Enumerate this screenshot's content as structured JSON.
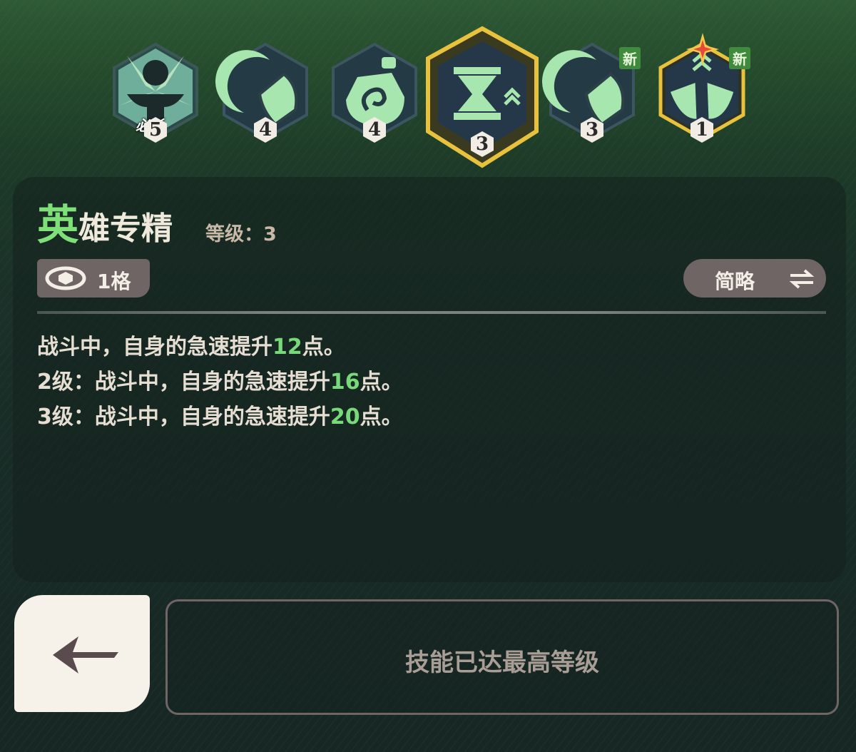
{
  "skill_bar": {
    "skills": [
      {
        "name": "anvil-skill",
        "level": "5",
        "tag": "必杀",
        "new": "",
        "selected": false
      },
      {
        "name": "crescent-leaf-skill",
        "level": "4",
        "tag": "",
        "new": "",
        "selected": false
      },
      {
        "name": "potion-skill",
        "level": "4",
        "tag": "",
        "new": "",
        "selected": false
      },
      {
        "name": "hourglass-skill",
        "level": "3",
        "tag": "",
        "new": "",
        "selected": true
      },
      {
        "name": "crescent-leaf-skill-2",
        "level": "3",
        "tag": "",
        "new": "新",
        "selected": false
      },
      {
        "name": "twin-leaves-skill",
        "level": "1",
        "tag": "",
        "new": "新",
        "selected": false
      }
    ]
  },
  "detail": {
    "title_first": "英",
    "title_rest": "雄专精",
    "level_text": "等级：3",
    "cell_label": "1格",
    "toggle_label": "简略",
    "desc": [
      {
        "pre": "战斗中，自身的急速提升",
        "num": "12",
        "post": "点。"
      },
      {
        "pre": "2级：战斗中，自身的急速提升",
        "num": "16",
        "post": "点。"
      },
      {
        "pre": "3级：战斗中，自身的急速提升",
        "num": "20",
        "post": "点。"
      }
    ]
  },
  "footer": {
    "max_label": "技能已达最高等级"
  },
  "colors": {
    "accent_green": "#78d97a",
    "gold": "#e8c23c",
    "chip": "#6e6564"
  }
}
